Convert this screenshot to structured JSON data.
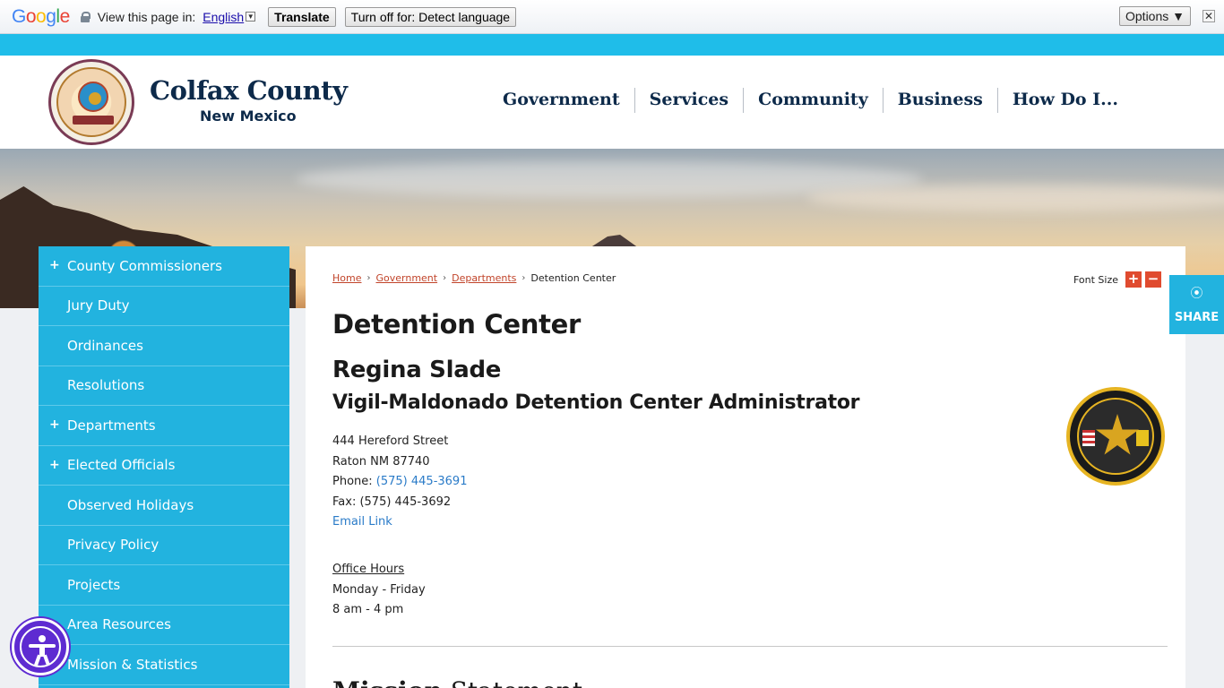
{
  "translate_bar": {
    "logo_text": "Google",
    "prompt": "View this page in:",
    "language": "English",
    "translate_button": "Translate",
    "turn_off_button": "Turn off for: Detect language",
    "options_button": "Options ▼",
    "close_symbol": "✕"
  },
  "header": {
    "site_title": "Colfax County",
    "site_subtitle": "New Mexico",
    "nav": [
      "Government",
      "Services",
      "Community",
      "Business",
      "How Do I..."
    ]
  },
  "sidebar": {
    "items": [
      {
        "label": "County Commissioners",
        "expandable": true
      },
      {
        "label": "Jury Duty",
        "expandable": false
      },
      {
        "label": "Ordinances",
        "expandable": false
      },
      {
        "label": "Resolutions",
        "expandable": false
      },
      {
        "label": "Departments",
        "expandable": true
      },
      {
        "label": "Elected Officials",
        "expandable": true
      },
      {
        "label": "Observed Holidays",
        "expandable": false
      },
      {
        "label": "Privacy Policy",
        "expandable": false
      },
      {
        "label": "Projects",
        "expandable": false
      },
      {
        "label": "Area Resources",
        "expandable": false
      },
      {
        "label": "Mission & Statistics",
        "expandable": false
      }
    ],
    "expand_symbol": "+"
  },
  "breadcrumb": {
    "home": "Home",
    "government": "Government",
    "departments": "Departments",
    "current": "Detention Center",
    "separator": "›"
  },
  "font_size": {
    "label": "Font Size",
    "increase": "+",
    "decrease": "−"
  },
  "page": {
    "title": "Detention Center",
    "person_name": "Regina Slade",
    "person_role": "Vigil-Maldonado Detention Center Administrator",
    "address_line1": "444 Hereford Street",
    "address_line2": "Raton NM 87740",
    "phone_label": "Phone: ",
    "phone": "(575) 445-3691",
    "fax": "Fax: (575) 445-3692",
    "email_link": "Email Link",
    "hours_title": "Office Hours",
    "hours_days": "Monday - Friday",
    "hours_time": "8 am - 4 pm",
    "next_heading_bold": "Mission",
    "next_heading_rest": " Statement"
  },
  "share": {
    "label": "SHARE",
    "icon": "share-icon"
  },
  "colors": {
    "accent_blue": "#22b3df",
    "navy": "#0d2a4a",
    "breadcrumb_link": "#c1442a",
    "font_button": "#e04b2f",
    "link_blue": "#2a7bc8",
    "a11y_purple": "#5e2bd1"
  }
}
